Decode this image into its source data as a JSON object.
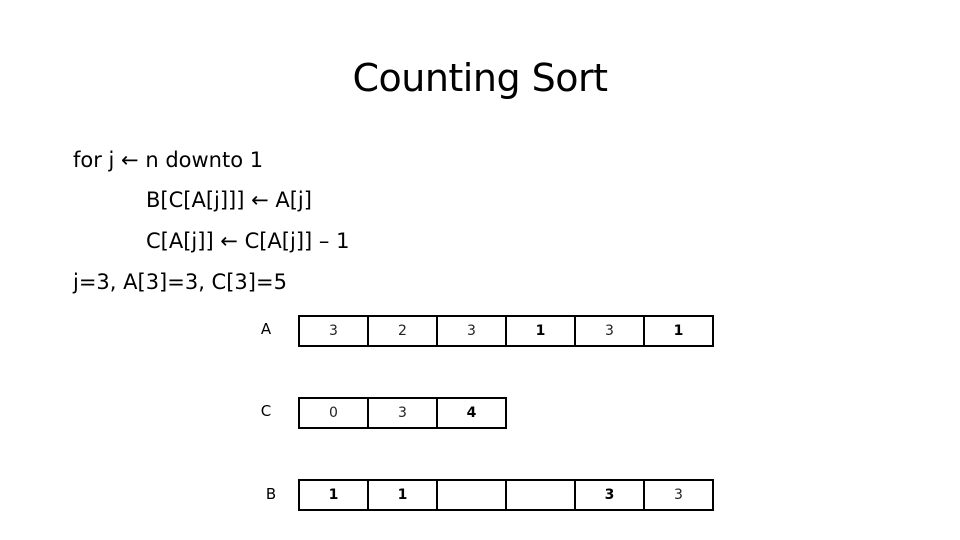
{
  "title": "Counting Sort",
  "code": {
    "line1": "for j ← n downto 1",
    "line2": "B[C[A[j]]] ← A[j]",
    "line3": "C[A[j]] ← C[A[j]] – 1",
    "line4": "j=3, A[3]=3, C[3]=5"
  },
  "arrays": {
    "A": {
      "label": "A",
      "cells": [
        {
          "value": "3",
          "bold": false
        },
        {
          "value": "2",
          "bold": false
        },
        {
          "value": "3",
          "bold": false
        },
        {
          "value": "1",
          "bold": true
        },
        {
          "value": "3",
          "bold": false
        },
        {
          "value": "1",
          "bold": true
        }
      ]
    },
    "C": {
      "label": "C",
      "cells": [
        {
          "value": "0",
          "bold": false
        },
        {
          "value": "3",
          "bold": false
        },
        {
          "value": "4",
          "bold": true
        }
      ]
    },
    "B": {
      "label": "B",
      "cells": [
        {
          "value": "1",
          "bold": true
        },
        {
          "value": "1",
          "bold": true
        },
        {
          "value": "",
          "bold": false
        },
        {
          "value": "",
          "bold": false
        },
        {
          "value": "3",
          "bold": true
        },
        {
          "value": "3",
          "bold": false
        }
      ]
    }
  }
}
